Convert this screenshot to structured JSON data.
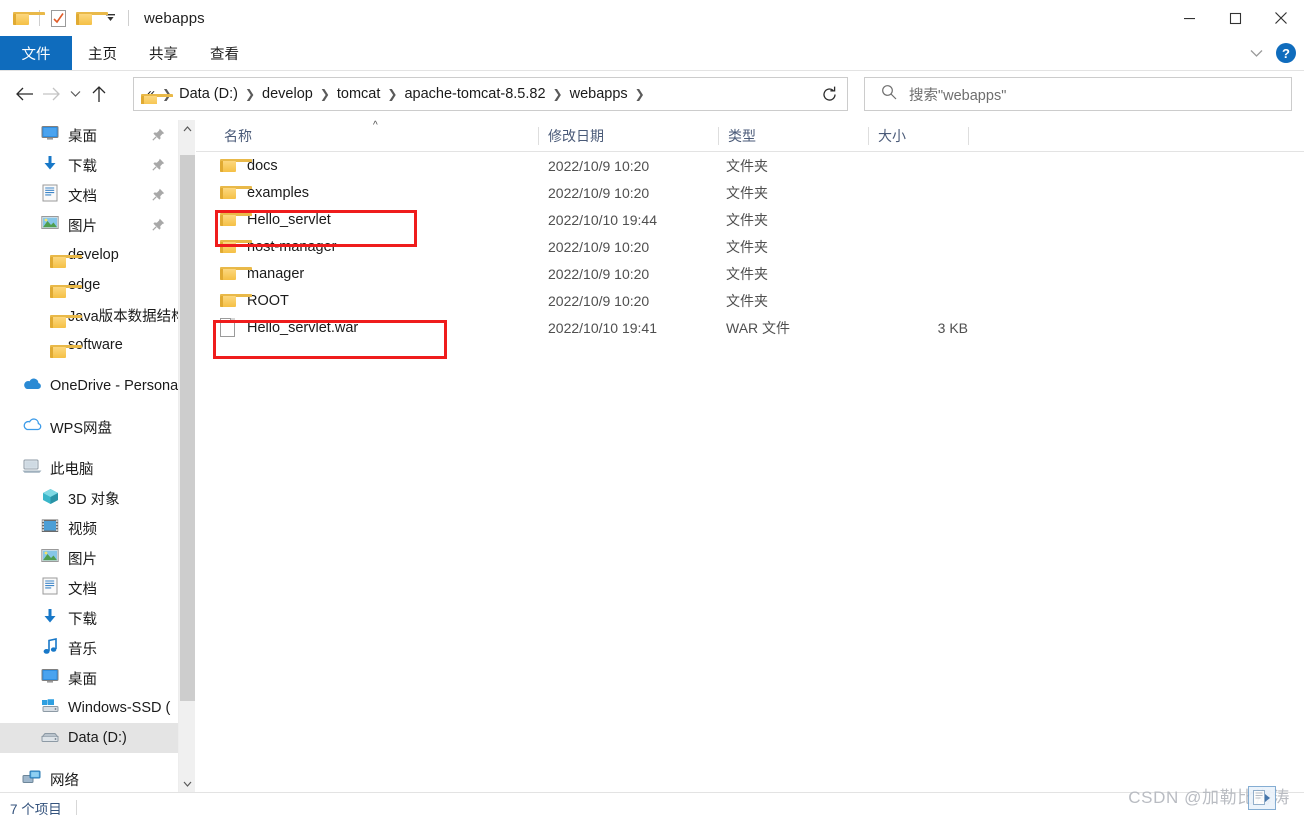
{
  "window": {
    "title": "webapps",
    "quick_access": [
      "folder-icon",
      "properties-icon",
      "new-folder-icon",
      "customize-dropdown-icon"
    ],
    "controls": {
      "minimize": "minimize-icon",
      "maximize": "maximize-icon",
      "close": "close-icon"
    }
  },
  "ribbon": {
    "tabs": [
      {
        "label": "文件",
        "active": true
      },
      {
        "label": "主页",
        "active": false
      },
      {
        "label": "共享",
        "active": false
      },
      {
        "label": "查看",
        "active": false
      }
    ],
    "collapse_icon": "chevron-down-icon",
    "help_label": "?"
  },
  "navbar": {
    "back_icon": "arrow-left-icon",
    "forward_icon": "arrow-right-icon",
    "recent_icon": "chevron-down-icon",
    "up_icon": "arrow-up-icon",
    "refresh_icon": "refresh-icon",
    "breadcrumb_overflow": "«",
    "breadcrumb": [
      "Data (D:)",
      "develop",
      "tomcat",
      "apache-tomcat-8.5.82",
      "webapps"
    ],
    "breadcrumb_dropdown_icon": "chevron-down-icon"
  },
  "search": {
    "icon": "search-icon",
    "placeholder": "搜索\"webapps\""
  },
  "sidebar": {
    "items": [
      {
        "label": "桌面",
        "icon": "desktop-icon",
        "indent": 1,
        "pinned": true,
        "selected": false,
        "gap_before": false
      },
      {
        "label": "下载",
        "icon": "download-icon",
        "indent": 1,
        "pinned": true,
        "selected": false,
        "gap_before": false
      },
      {
        "label": "文档",
        "icon": "document-icon",
        "indent": 1,
        "pinned": true,
        "selected": false,
        "gap_before": false
      },
      {
        "label": "图片",
        "icon": "pictures-icon",
        "indent": 1,
        "pinned": true,
        "selected": false,
        "gap_before": false
      },
      {
        "label": "develop",
        "icon": "folder-icon",
        "indent": 1,
        "pinned": false,
        "selected": false,
        "gap_before": false
      },
      {
        "label": "edge",
        "icon": "folder-icon",
        "indent": 1,
        "pinned": false,
        "selected": false,
        "gap_before": false
      },
      {
        "label": "Java版本数据结构",
        "icon": "folder-icon",
        "indent": 1,
        "pinned": false,
        "selected": false,
        "gap_before": false
      },
      {
        "label": "software",
        "icon": "folder-icon",
        "indent": 1,
        "pinned": false,
        "selected": false,
        "gap_before": false
      },
      {
        "label": "OneDrive - Personal",
        "icon": "onedrive-icon",
        "indent": 0,
        "pinned": false,
        "selected": false,
        "gap_before": true
      },
      {
        "label": "WPS网盘",
        "icon": "wps-cloud-icon",
        "indent": 0,
        "pinned": false,
        "selected": false,
        "gap_before": true
      },
      {
        "label": "此电脑",
        "icon": "this-pc-icon",
        "indent": 0,
        "pinned": false,
        "selected": false,
        "gap_before": true
      },
      {
        "label": "3D 对象",
        "icon": "3d-objects-icon",
        "indent": 1,
        "pinned": false,
        "selected": false,
        "gap_before": false
      },
      {
        "label": "视频",
        "icon": "videos-icon",
        "indent": 1,
        "pinned": false,
        "selected": false,
        "gap_before": false
      },
      {
        "label": "图片",
        "icon": "pictures-icon",
        "indent": 1,
        "pinned": false,
        "selected": false,
        "gap_before": false
      },
      {
        "label": "文档",
        "icon": "document-icon",
        "indent": 1,
        "pinned": false,
        "selected": false,
        "gap_before": false
      },
      {
        "label": "下载",
        "icon": "download-icon",
        "indent": 1,
        "pinned": false,
        "selected": false,
        "gap_before": false
      },
      {
        "label": "音乐",
        "icon": "music-icon",
        "indent": 1,
        "pinned": false,
        "selected": false,
        "gap_before": false
      },
      {
        "label": "桌面",
        "icon": "desktop-icon",
        "indent": 1,
        "pinned": false,
        "selected": false,
        "gap_before": false
      },
      {
        "label": "Windows-SSD (",
        "icon": "windows-drive-icon",
        "indent": 1,
        "pinned": false,
        "selected": false,
        "gap_before": false
      },
      {
        "label": "Data (D:)",
        "icon": "drive-icon",
        "indent": 1,
        "pinned": false,
        "selected": true,
        "gap_before": false
      },
      {
        "label": "网络",
        "icon": "network-icon",
        "indent": 0,
        "pinned": false,
        "selected": false,
        "gap_before": true
      }
    ],
    "scrollbar": {
      "up_icon": "chevron-up-icon",
      "down_icon": "chevron-down-icon"
    }
  },
  "filelist": {
    "columns": [
      {
        "label": "名称",
        "key": "name"
      },
      {
        "label": "修改日期",
        "key": "date"
      },
      {
        "label": "类型",
        "key": "type"
      },
      {
        "label": "大小",
        "key": "size"
      }
    ],
    "sort_indicator": "^",
    "rows": [
      {
        "name": "docs",
        "date": "2022/10/9 10:20",
        "type": "文件夹",
        "size": "",
        "icon": "folder-icon",
        "highlighted": false
      },
      {
        "name": "examples",
        "date": "2022/10/9 10:20",
        "type": "文件夹",
        "size": "",
        "icon": "folder-icon",
        "highlighted": false
      },
      {
        "name": "Hello_servlet",
        "date": "2022/10/10 19:44",
        "type": "文件夹",
        "size": "",
        "icon": "folder-icon",
        "highlighted": true
      },
      {
        "name": "host-manager",
        "date": "2022/10/9 10:20",
        "type": "文件夹",
        "size": "",
        "icon": "folder-icon",
        "highlighted": false
      },
      {
        "name": "manager",
        "date": "2022/10/9 10:20",
        "type": "文件夹",
        "size": "",
        "icon": "folder-icon",
        "highlighted": false
      },
      {
        "name": "ROOT",
        "date": "2022/10/9 10:20",
        "type": "文件夹",
        "size": "",
        "icon": "folder-icon",
        "highlighted": false
      },
      {
        "name": "Hello_servlet.war",
        "date": "2022/10/10 19:41",
        "type": "WAR 文件",
        "size": "3 KB",
        "icon": "file-icon",
        "highlighted": true
      }
    ]
  },
  "statusbar": {
    "item_count": "7 个项目"
  },
  "watermark": {
    "text": "CSDN @加勒比海涛"
  },
  "colors": {
    "accent": "#0f6cbd",
    "annotation_red": "#ef1c1c",
    "folder_yellow": "#f5c045",
    "selection_gray": "#e4e4e4",
    "header_text": "#4a5a78"
  }
}
